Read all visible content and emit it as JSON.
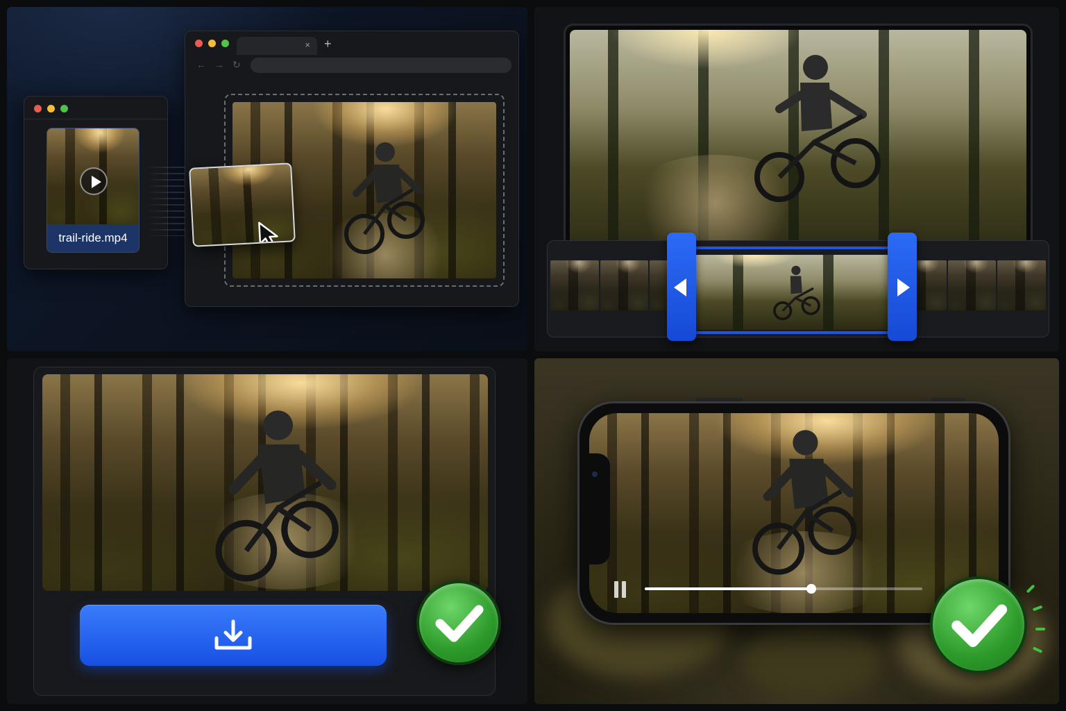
{
  "upload": {
    "file_name": "trail-ride.mp4",
    "tab_close_glyph": "×",
    "new_tab_glyph": "+",
    "nav_back_glyph": "←",
    "nav_forward_glyph": "→",
    "nav_reload_glyph": "↻",
    "icons": [
      "play-icon",
      "cursor-arrow-icon"
    ]
  },
  "trim": {
    "handles": [
      "chevron-left-icon",
      "chevron-right-icon"
    ],
    "accent": "#1f56e0"
  },
  "download": {
    "icon": "download-icon",
    "status_icon": "checkmark-icon",
    "button_color": "#2a68f2",
    "check_color": "#2c9a2a"
  },
  "playback": {
    "progress": 0.6,
    "icon": "pause-icon",
    "status_icon": "checkmark-icon"
  }
}
